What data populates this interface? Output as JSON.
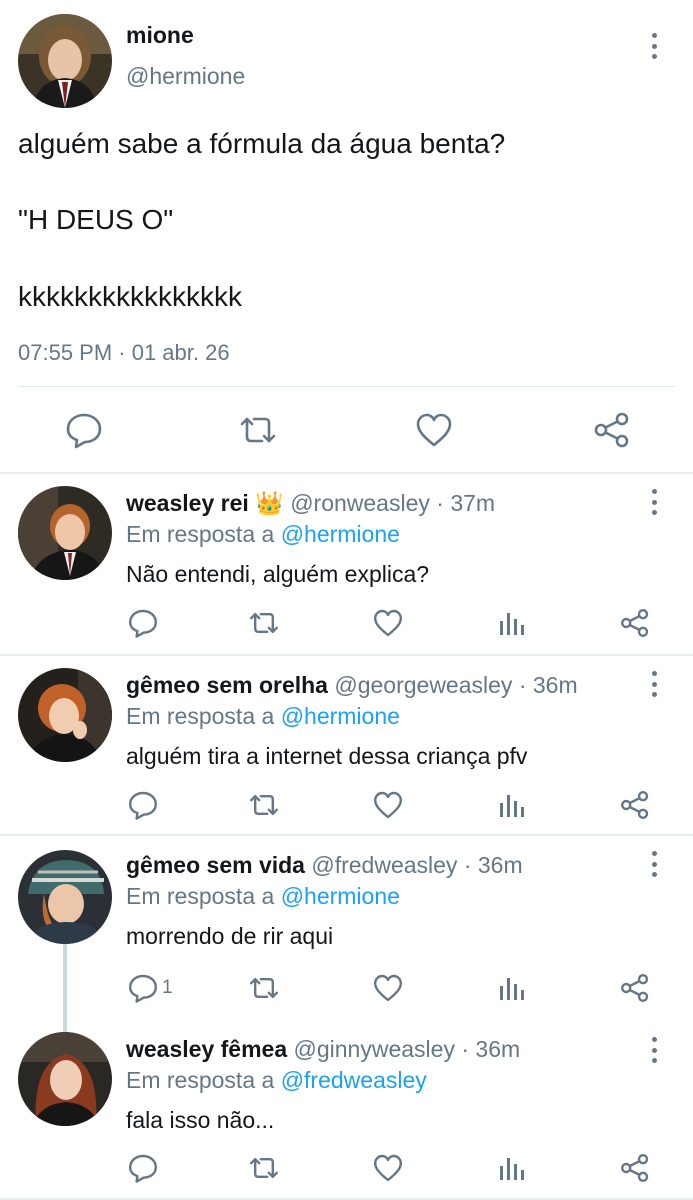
{
  "main_tweet": {
    "name": "mione",
    "handle": "@hermione",
    "lines": [
      "alguém sabe a fórmula da água benta?",
      "\"H DEUS O\"",
      "kkkkkkkkkkkkkkkk"
    ],
    "timestamp": "07:55 PM · 01 abr. 26",
    "actions": [
      "reply-icon",
      "retweet-icon",
      "like-icon",
      "share-icon"
    ]
  },
  "replies": [
    {
      "name": "weasley rei",
      "emoji": "👑",
      "handle": "@ronweasley",
      "time": "37m",
      "in_reply_label": "Em resposta a",
      "in_reply_to": "@hermione",
      "text": "Não entendi, alguém explica?",
      "reply_count": ""
    },
    {
      "name": "gêmeo sem orelha",
      "emoji": "",
      "handle": "@georgeweasley",
      "time": "36m",
      "in_reply_label": "Em resposta a",
      "in_reply_to": "@hermione",
      "text": "alguém tira a internet dessa criança pfv",
      "reply_count": ""
    },
    {
      "name": "gêmeo sem vida",
      "emoji": "",
      "handle": "@fredweasley",
      "time": "36m",
      "in_reply_label": "Em resposta a",
      "in_reply_to": "@hermione",
      "text": "morrendo de rir aqui",
      "reply_count": "1"
    },
    {
      "name": "weasley fêmea",
      "emoji": "",
      "handle": "@ginnyweasley",
      "time": "36m",
      "in_reply_label": "Em resposta a",
      "in_reply_to": "@fredweasley",
      "text": "fala isso não...",
      "reply_count": ""
    }
  ],
  "dot_separator": "·",
  "colors": {
    "text": "#14171a",
    "secondary": "#657786",
    "link": "#1da1f2",
    "divider": "#e6ecf0"
  }
}
